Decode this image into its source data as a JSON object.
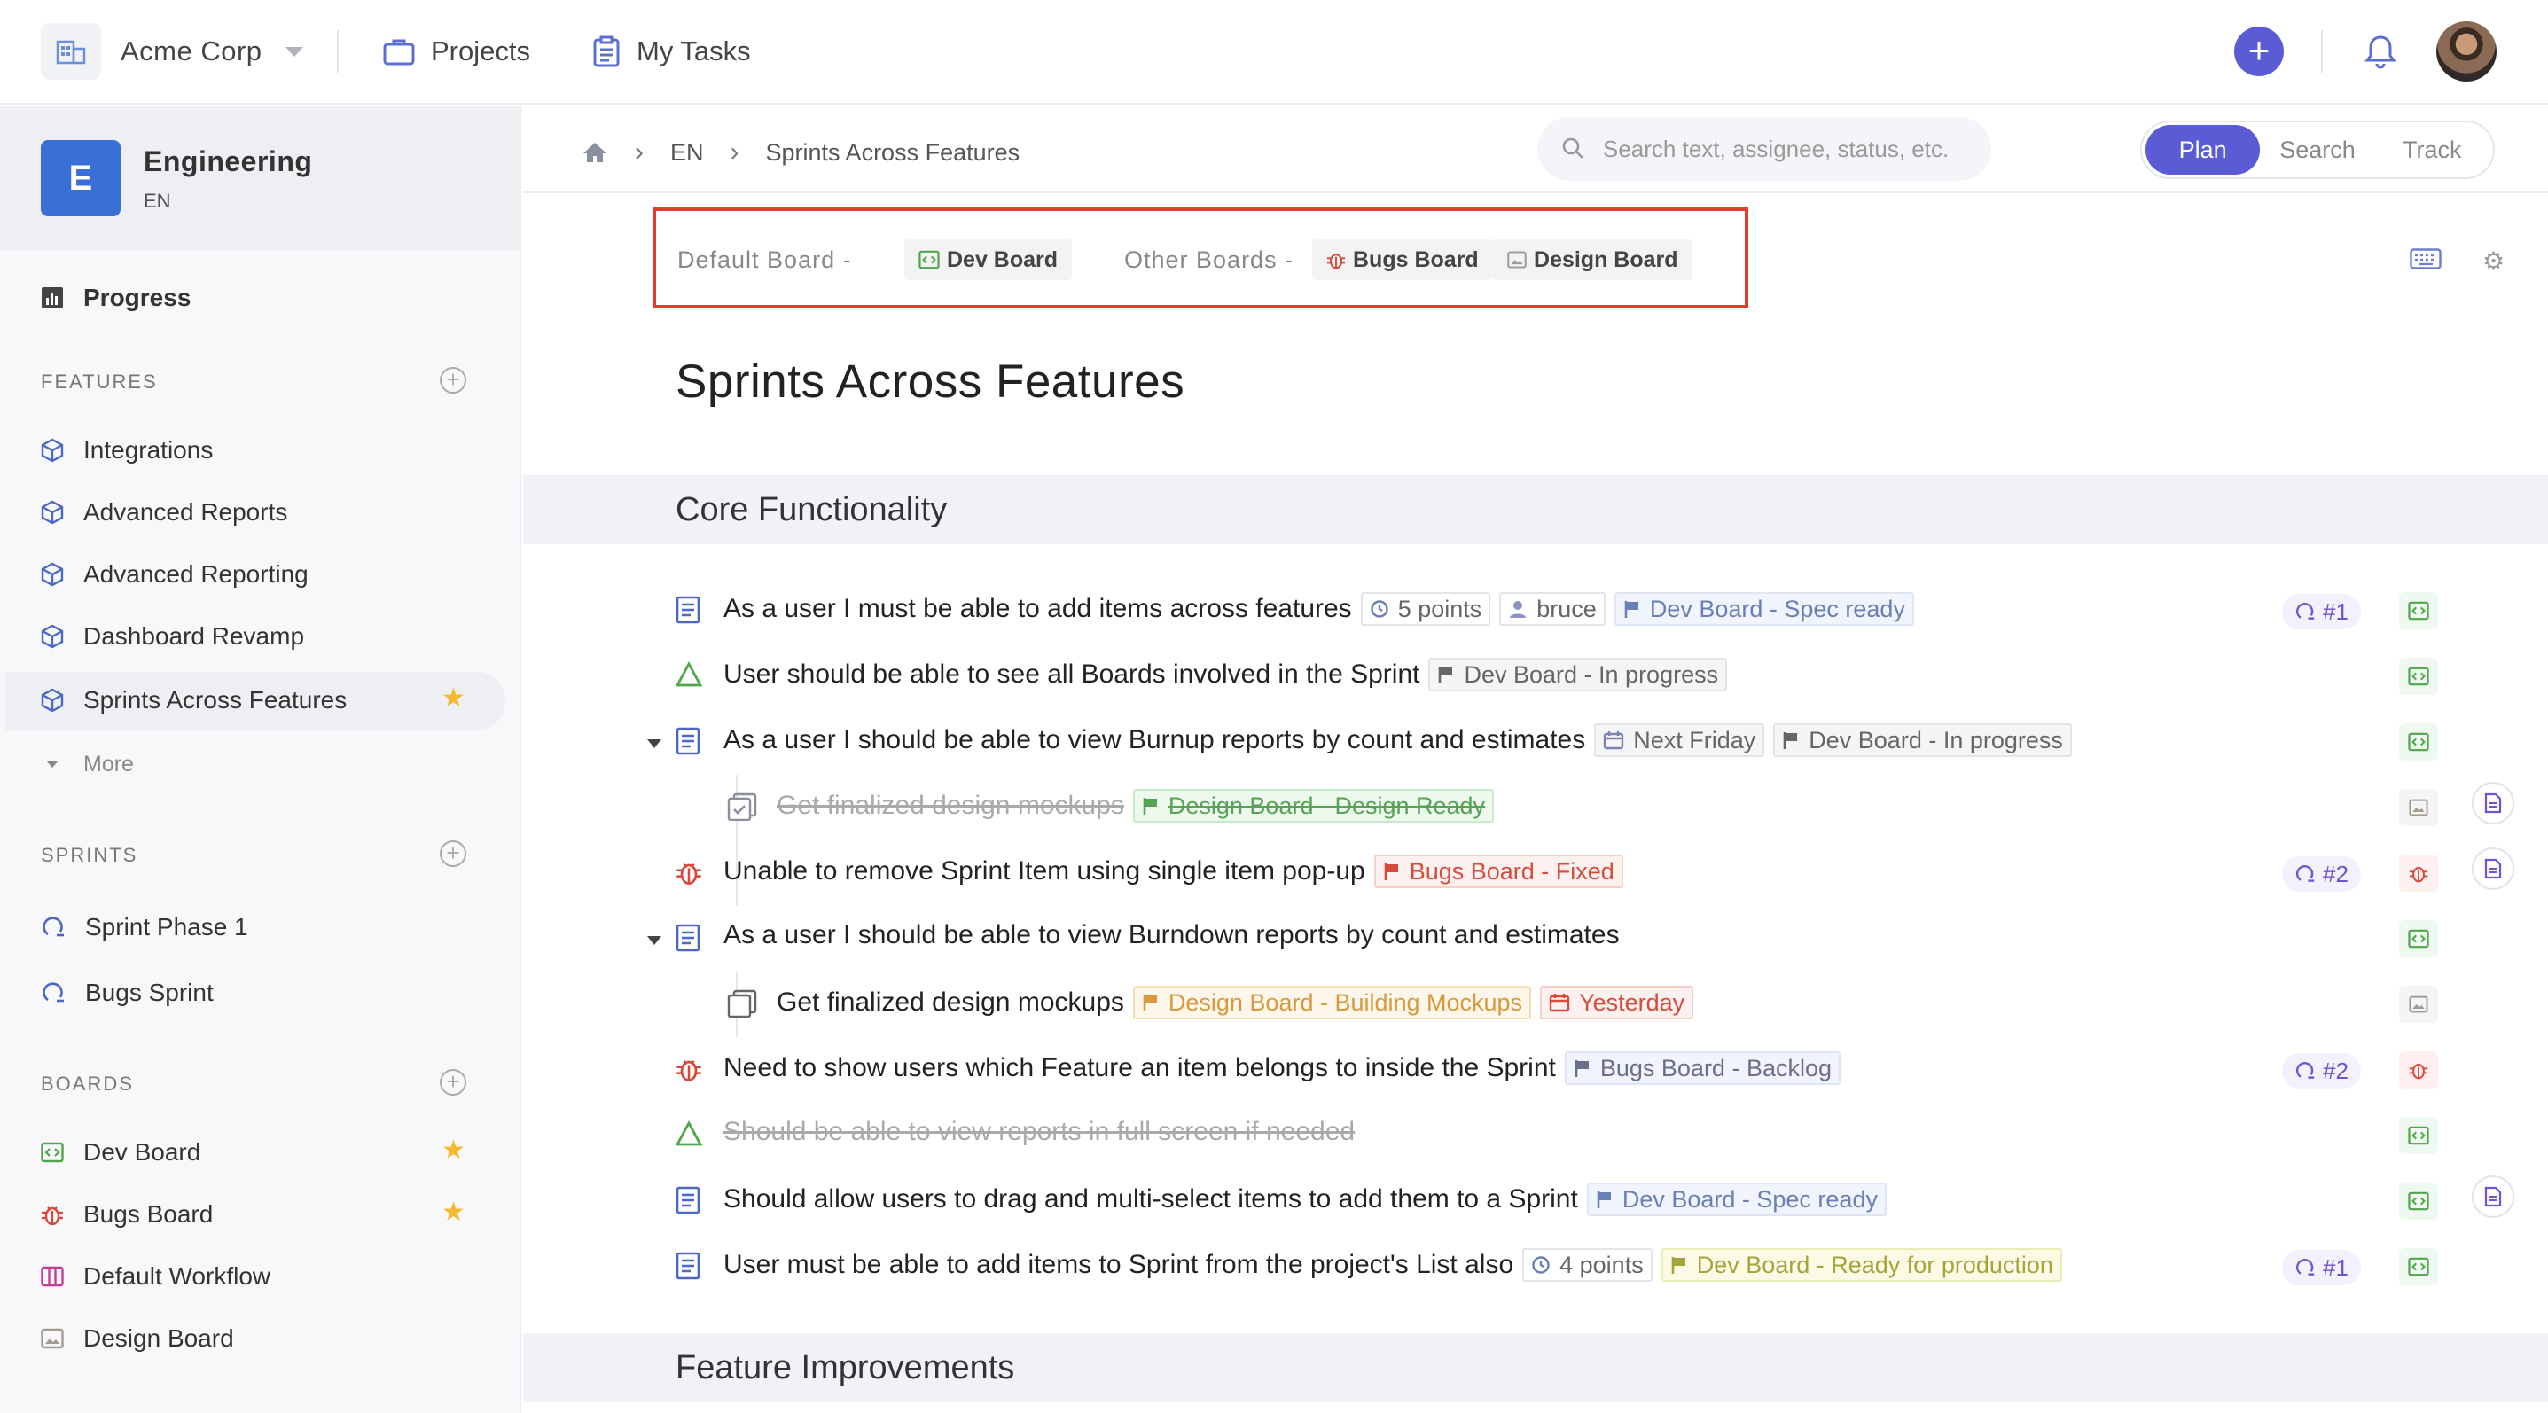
{
  "topbar": {
    "org_name": "Acme Corp",
    "nav": [
      {
        "label": "Projects",
        "icon": "briefcase-icon"
      },
      {
        "label": "My Tasks",
        "icon": "clipboard-icon"
      }
    ],
    "add_label": "+"
  },
  "sidebar": {
    "project": {
      "badge": "E",
      "name": "Engineering",
      "key": "EN"
    },
    "progress_label": "Progress",
    "features_heading": "FEATURES",
    "features": [
      "Integrations",
      "Advanced Reports",
      "Advanced Reporting",
      "Dashboard Revamp",
      "Sprints Across Features"
    ],
    "more_label": "More",
    "sprints_heading": "SPRINTS",
    "sprints": [
      "Sprint Phase 1",
      "Bugs Sprint"
    ],
    "boards_heading": "BOARDS",
    "boards": [
      "Dev Board",
      "Bugs Board",
      "Default Workflow",
      "Design Board"
    ]
  },
  "breadcrumb": {
    "key": "EN",
    "page": "Sprints Across Features"
  },
  "search": {
    "placeholder": "Search text, assignee, status, etc."
  },
  "modes": [
    "Plan",
    "Search",
    "Track"
  ],
  "active_mode": "Plan",
  "boards_bar": {
    "default_label": "Default Board -",
    "default_board": "Dev Board",
    "other_label": "Other Boards -",
    "other_boards": [
      "Bugs Board",
      "Design Board"
    ]
  },
  "page_title": "Sprints Across Features",
  "sections": [
    "Core Functionality",
    "Feature Improvements"
  ],
  "items": {
    "r1": {
      "text": "As a user I must be able to add items across features",
      "points": "5 points",
      "assignee": "bruce",
      "status": "Dev Board - Spec ready",
      "sprint": "#1"
    },
    "r2": {
      "text": "User should be able to see all Boards involved in the Sprint",
      "status": "Dev Board - In progress"
    },
    "r3": {
      "text": "As a user I should be able to view Burnup reports by count and estimates",
      "date": "Next Friday",
      "status": "Dev Board - In progress"
    },
    "r4": {
      "text": "Get finalized design mockups",
      "status": "Design Board - Design Ready"
    },
    "r5": {
      "text": "Unable to remove Sprint Item using single item pop-up",
      "status": "Bugs Board - Fixed",
      "sprint": "#2"
    },
    "r6": {
      "text": "As a user I should be able to view Burndown reports by count and estimates"
    },
    "r7": {
      "text": "Get finalized design mockups",
      "status": "Design Board - Building Mockups",
      "date": "Yesterday"
    },
    "r8": {
      "text": "Need to show users which Feature an item belongs to inside the Sprint",
      "status": "Bugs Board - Backlog",
      "sprint": "#2"
    },
    "r9": {
      "text": "Should be able to view reports in full screen if needed"
    },
    "r10": {
      "text": "Should allow users to drag and multi-select items to add them to a Sprint",
      "status": "Dev Board - Spec ready"
    },
    "r11": {
      "text": "User must be able to add items to Sprint from the project's List also",
      "points": "4 points",
      "status": "Dev Board - Ready for production",
      "sprint": "#1"
    }
  },
  "colors": {
    "accent": "#5b5bd6",
    "highlight_box": "#e53c2e",
    "project_badge": "#3b6fd8",
    "star": "#f5b82e"
  }
}
